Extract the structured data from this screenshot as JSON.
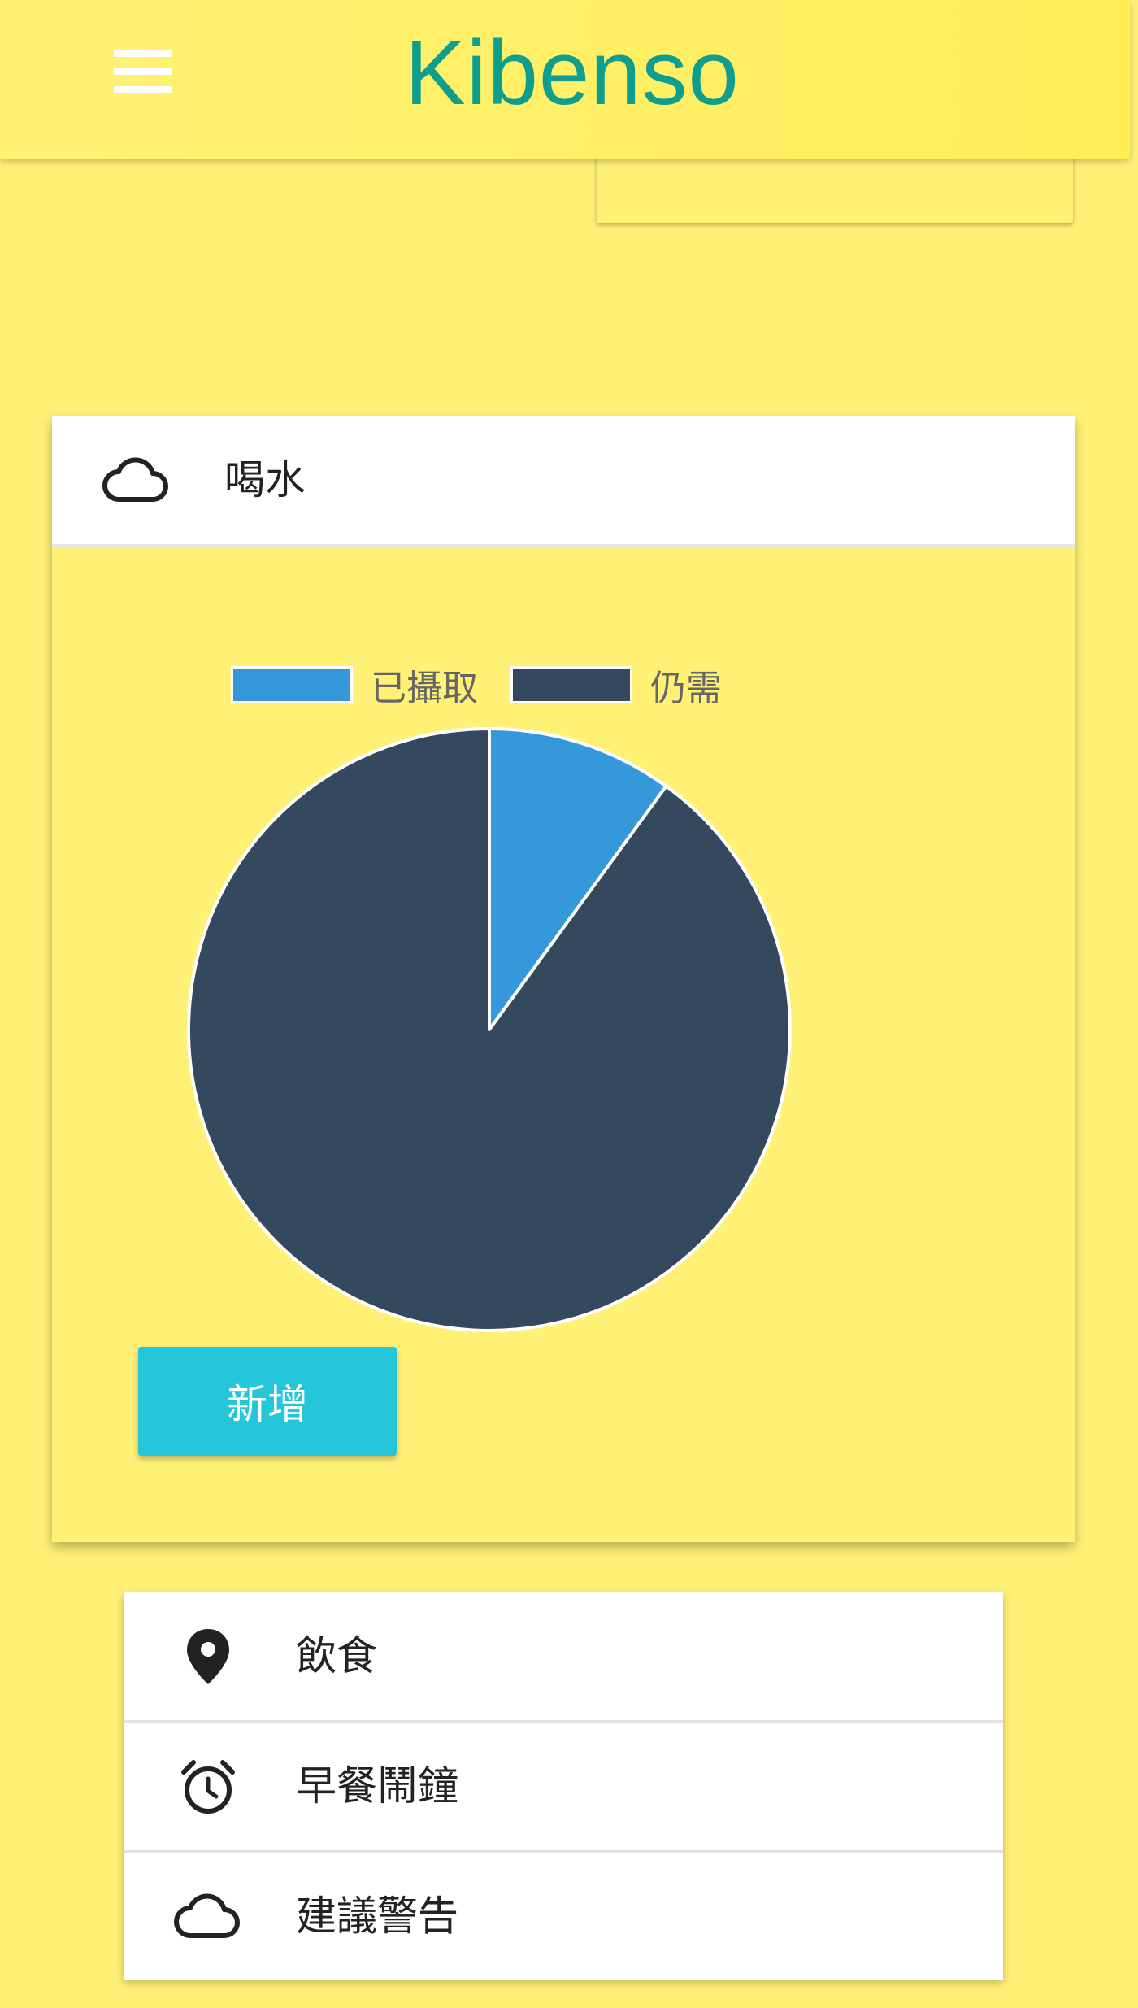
{
  "app_bar": {
    "title": "Kibenso",
    "menu_icon": "menu-icon",
    "title_color": "#0E9E8E",
    "background": "#FFEE58"
  },
  "water_card": {
    "title": "喝水",
    "icon": "cloud-icon",
    "add_button_label": "新增",
    "add_button_color": "#26C6DA"
  },
  "chart_data": {
    "type": "pie",
    "slices": [
      {
        "label": "已攝取",
        "value": 10,
        "color": "#3498DB"
      },
      {
        "label": "仍需",
        "value": 90,
        "color": "#34495E"
      }
    ],
    "legend_position": "top"
  },
  "nav": {
    "items": [
      {
        "label": "飲食",
        "icon": "location-pin-icon"
      },
      {
        "label": "早餐鬧鐘",
        "icon": "alarm-clock-icon"
      },
      {
        "label": "建議警告",
        "icon": "cloud-icon"
      }
    ]
  },
  "theme": {
    "page_background": "#FFF176"
  }
}
